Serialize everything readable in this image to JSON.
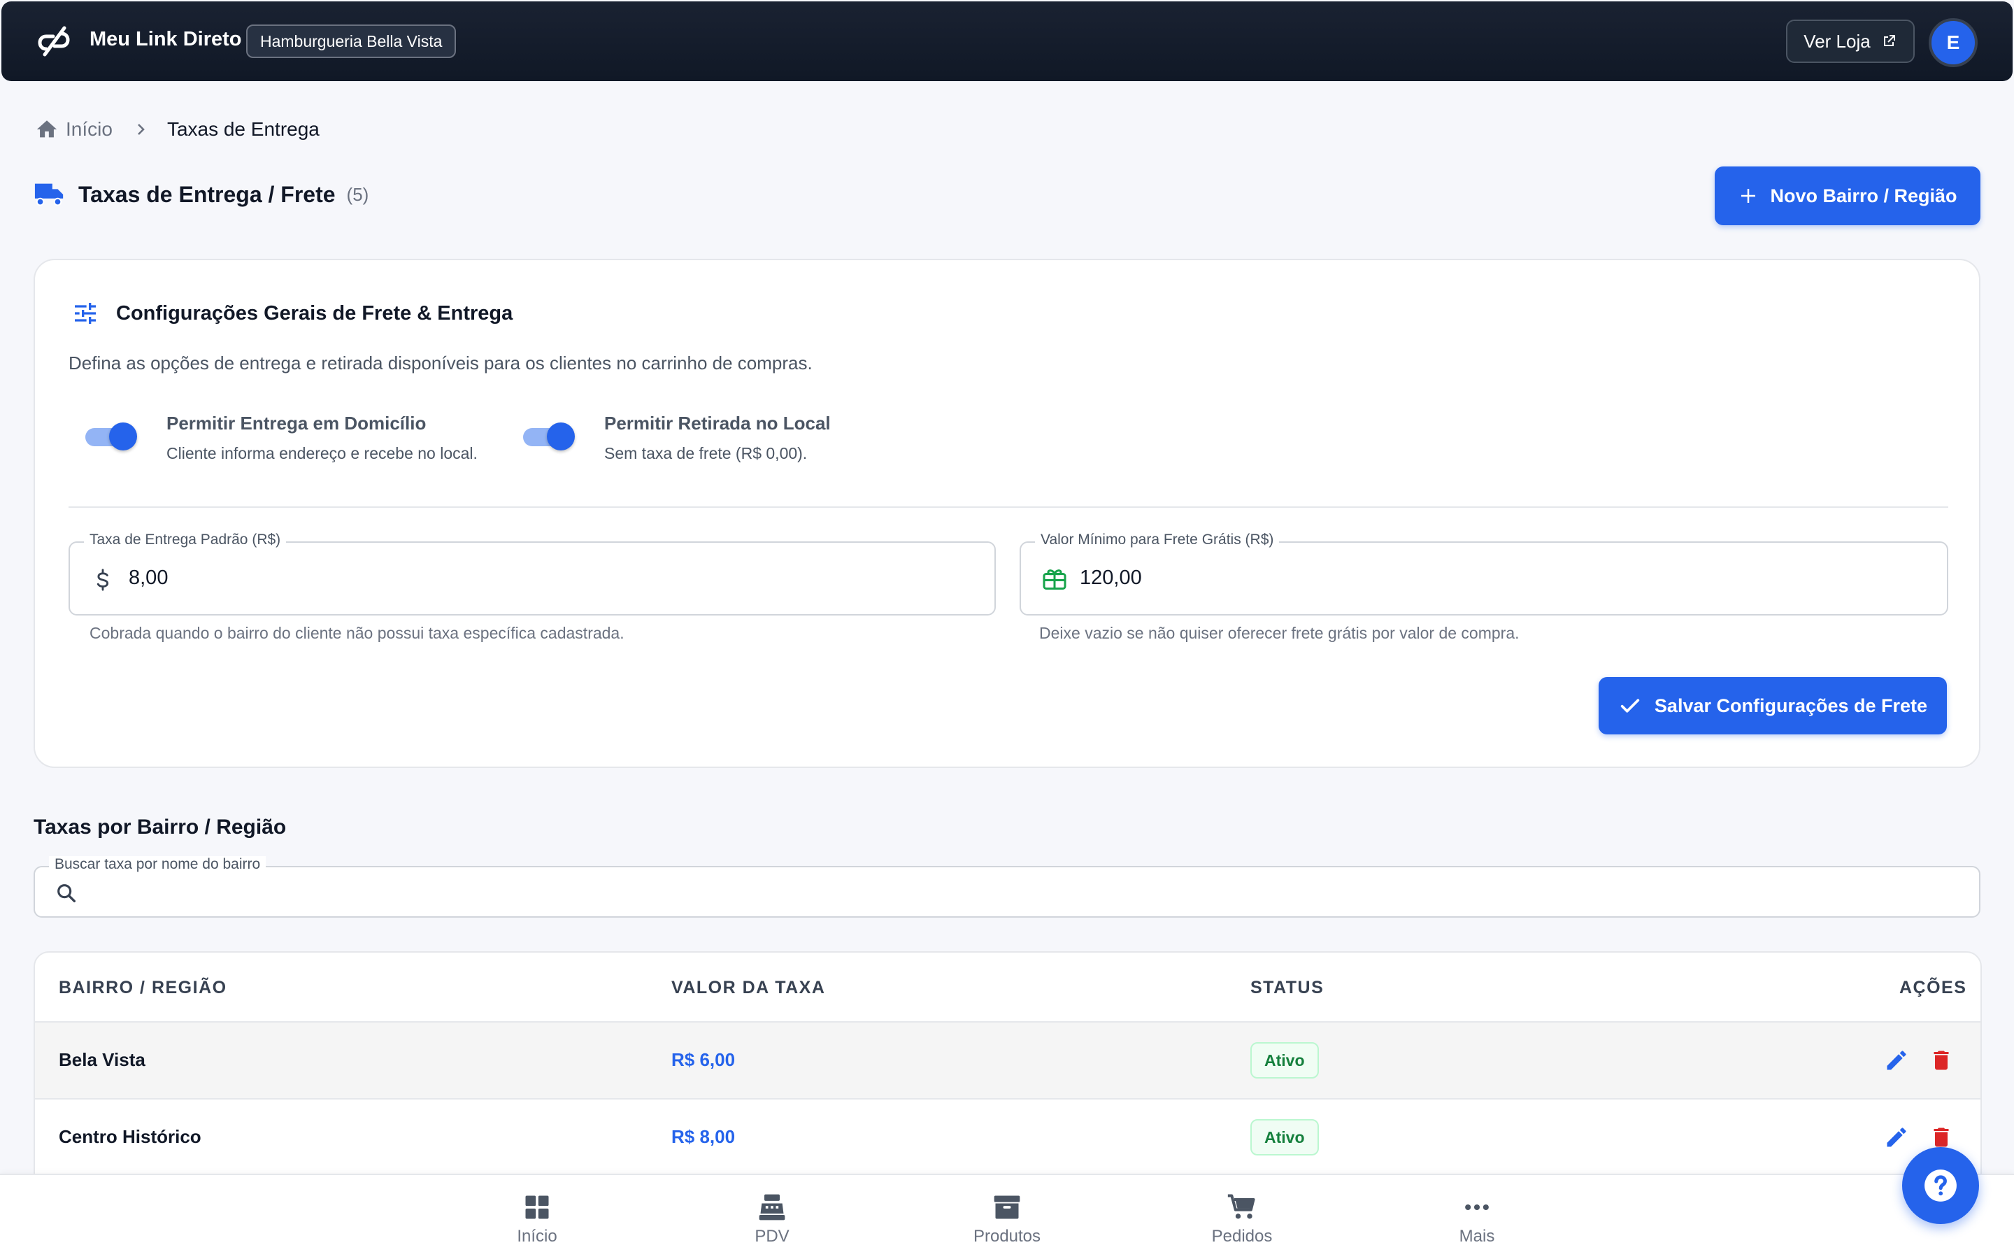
{
  "header": {
    "brand": "Meu Link Direto",
    "store_name": "Hamburgueria Bella Vista",
    "view_store_label": "Ver Loja",
    "avatar_initial": "E"
  },
  "breadcrumb": {
    "home": "Início",
    "current": "Taxas de Entrega"
  },
  "page": {
    "title": "Taxas de Entrega / Frete",
    "count": "(5)",
    "new_button": "Novo Bairro / Região"
  },
  "settings": {
    "title": "Configurações Gerais de Frete & Entrega",
    "description": "Defina as opções de entrega e retirada disponíveis para os clientes no carrinho de compras.",
    "delivery_toggle": {
      "title": "Permitir Entrega em Domicílio",
      "subtitle": "Cliente informa endereço e recebe no local.",
      "enabled": true
    },
    "pickup_toggle": {
      "title": "Permitir Retirada no Local",
      "subtitle": "Sem taxa de frete (R$ 0,00).",
      "enabled": true
    },
    "default_fee": {
      "label": "Taxa de Entrega Padrão (R$)",
      "value": "8,00",
      "help": "Cobrada quando o bairro do cliente não possui taxa específica cadastrada."
    },
    "free_shipping_min": {
      "label": "Valor Mínimo para Frete Grátis (R$)",
      "value": "120,00",
      "help": "Deixe vazio se não quiser oferecer frete grátis por valor de compra."
    },
    "save_button": "Salvar Configurações de Frete"
  },
  "regions": {
    "title": "Taxas por Bairro / Região",
    "search_label": "Buscar taxa por nome do bairro",
    "columns": [
      "BAIRRO / REGIÃO",
      "VALOR DA TAXA",
      "STATUS",
      "AÇÕES"
    ],
    "rows": [
      {
        "name": "Bela Vista",
        "fee": "R$ 6,00",
        "status": "Ativo"
      },
      {
        "name": "Centro Histórico",
        "fee": "R$ 8,00",
        "status": "Ativo"
      }
    ]
  },
  "bottom_nav": {
    "items": [
      {
        "label": "Início",
        "icon": "dashboard-icon"
      },
      {
        "label": "PDV",
        "icon": "cash-register-icon"
      },
      {
        "label": "Produtos",
        "icon": "archive-box-icon"
      },
      {
        "label": "Pedidos",
        "icon": "cart-icon"
      },
      {
        "label": "Mais",
        "icon": "more-dots-icon"
      }
    ]
  },
  "colors": {
    "primary": "#2563eb",
    "header_bg": "#101826",
    "success": "#15803d",
    "danger": "#dc2626"
  }
}
